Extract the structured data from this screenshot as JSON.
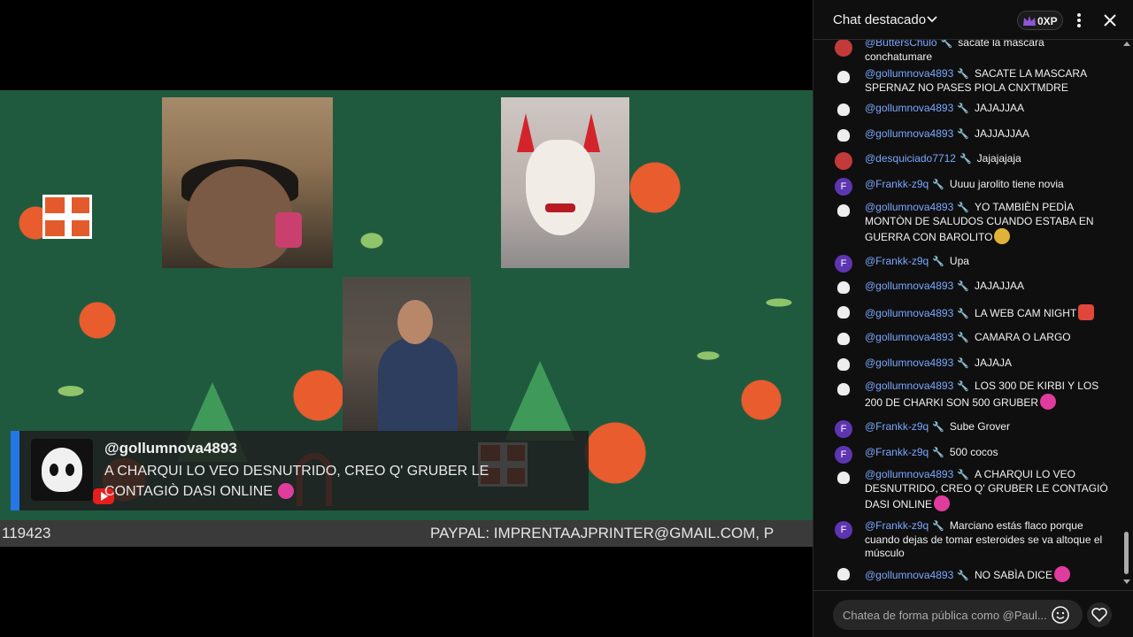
{
  "stream": {
    "comment": {
      "username": "@gollumnova4893",
      "text": "A CHARQUI LO VEO DESNUTRIDO, CREO Q' GRUBER LE CONTAGIÒ DASI ONLINE"
    },
    "ticker": {
      "left": "119423",
      "right": "PAYPAL: IMPRENTAAJPRINTER@GMAIL.COM, P"
    }
  },
  "chat": {
    "title": "Chat destacado",
    "xp": "0XP",
    "input_placeholder": "Chatea de forma pública como @Paul...",
    "messages": [
      {
        "user": "@ButtersChulo",
        "text": "sacate la mascara conchatumare",
        "avatar": "image"
      },
      {
        "user": "@gollumnova4893",
        "text": "SACATE LA MASCARA SPERNAZ NO PASES PIOLA CNXTMDRE",
        "avatar": "skull"
      },
      {
        "user": "@gollumnova4893",
        "text": "JAJAJJAA",
        "avatar": "skull"
      },
      {
        "user": "@gollumnova4893",
        "text": "JAJJAJJAA",
        "avatar": "skull"
      },
      {
        "user": "@desquiciado7712",
        "text": "Jajajajaja",
        "avatar": "image"
      },
      {
        "user": "@Frankk-z9q",
        "text": "Uuuu jarolito tiene novia",
        "avatar": "F"
      },
      {
        "user": "@gollumnova4893",
        "text": "YO TAMBIÈN PEDÌA MONTÒN DE SALUDOS CUANDO ESTABA EN GUERRA CON BAROLITO",
        "avatar": "skull"
      },
      {
        "user": "@Frankk-z9q",
        "text": "Upa",
        "avatar": "F"
      },
      {
        "user": "@gollumnova4893",
        "text": "JAJAJJAA",
        "avatar": "skull"
      },
      {
        "user": "@gollumnova4893",
        "text": "LA WEB CAM NIGHT",
        "avatar": "skull"
      },
      {
        "user": "@gollumnova4893",
        "text": "CAMARA O LARGO",
        "avatar": "skull"
      },
      {
        "user": "@gollumnova4893",
        "text": "JAJAJA",
        "avatar": "skull"
      },
      {
        "user": "@gollumnova4893",
        "text": "LOS 300 DE KIRBI Y LOS 200 DE CHARKI SON 500 GRUBER",
        "avatar": "skull"
      },
      {
        "user": "@Frankk-z9q",
        "text": "Sube Grover",
        "avatar": "F"
      },
      {
        "user": "@Frankk-z9q",
        "text": "500 cocos",
        "avatar": "F"
      },
      {
        "user": "@gollumnova4893",
        "text": "A CHARQUI LO VEO DESNUTRIDO, CREO Q' GRUBER LE CONTAGIÒ DASI ONLINE",
        "avatar": "skull"
      },
      {
        "user": "@Frankk-z9q",
        "text": "Marciano estás flaco porque cuando dejas de tomar esteroides se va altoque el músculo",
        "avatar": "F"
      },
      {
        "user": "@gollumnova4893",
        "text": "NO SABÌA DICE",
        "avatar": "skull"
      }
    ]
  },
  "colors": {
    "username": "#7aa7ff",
    "background": "#0f0f0f",
    "accent": "#2576e6"
  }
}
